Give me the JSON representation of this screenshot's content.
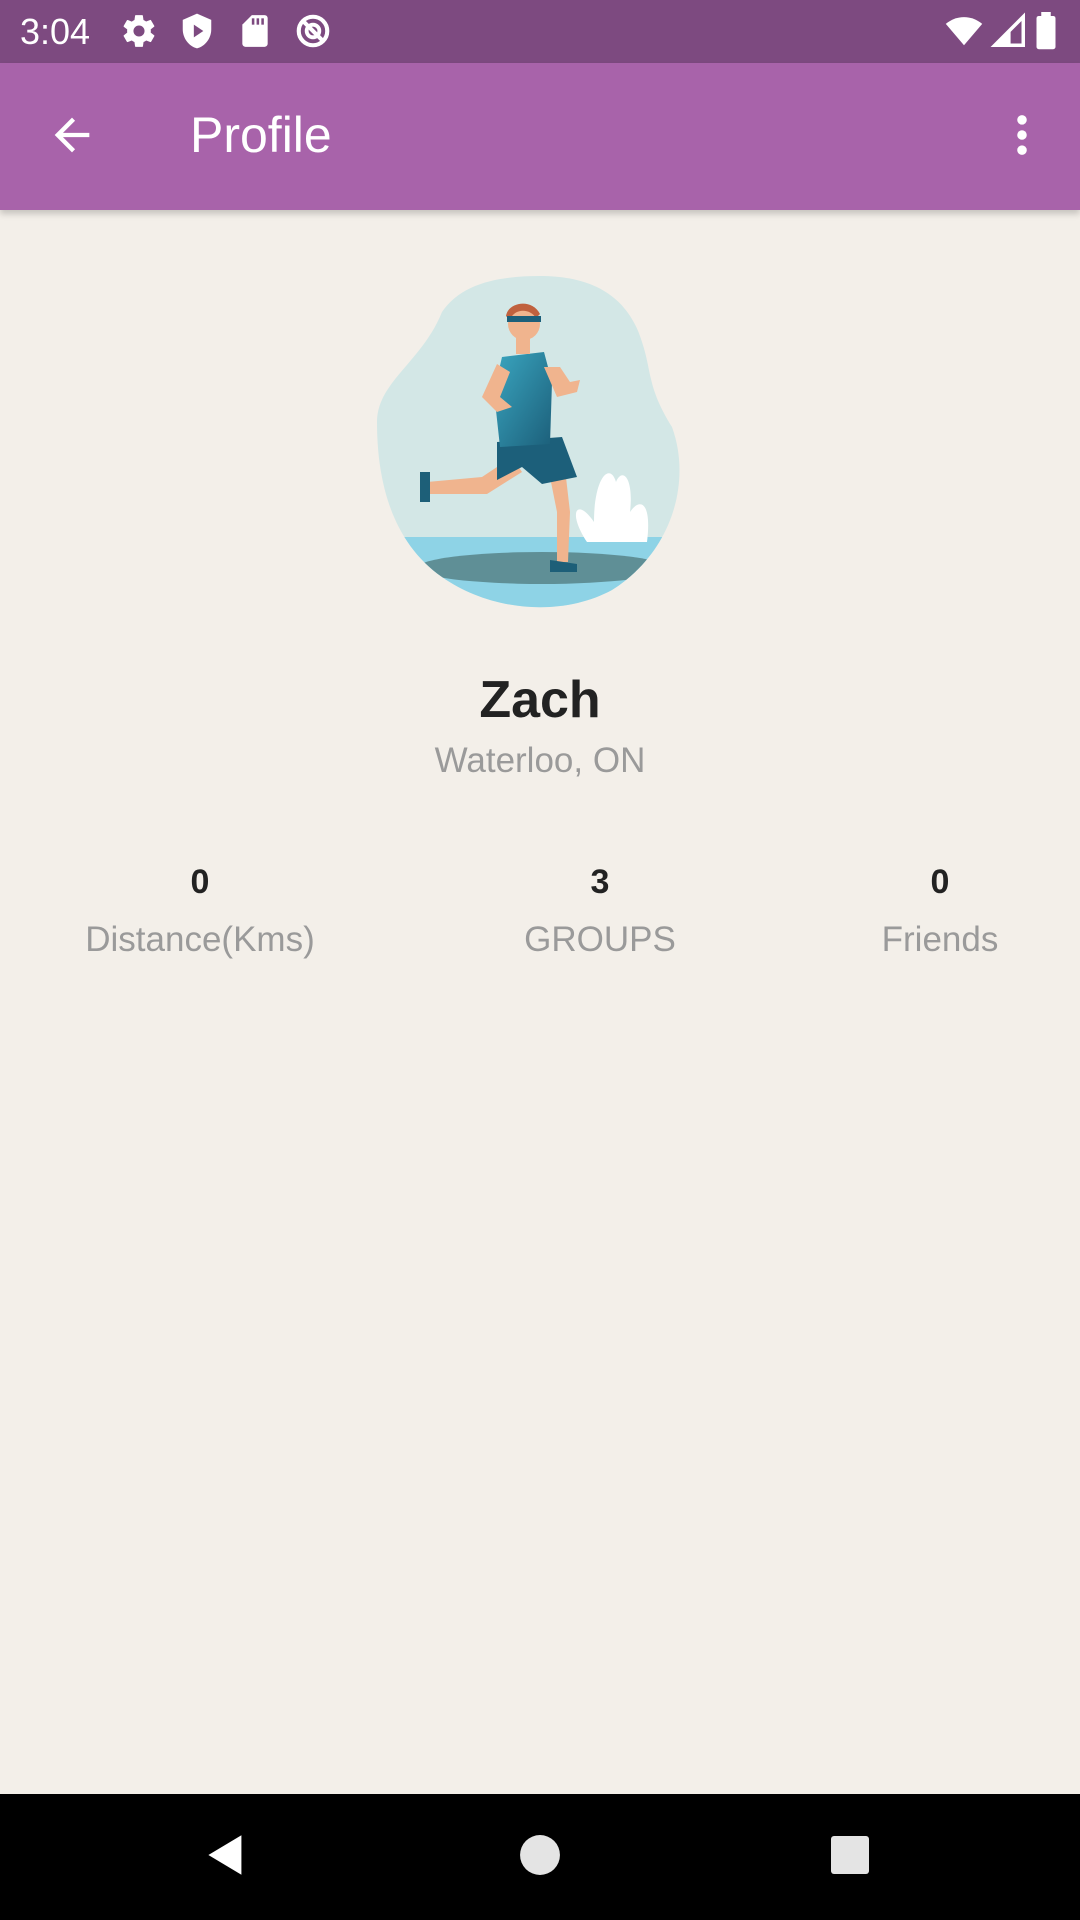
{
  "status_bar": {
    "time": "3:04",
    "left_icons": [
      "gear-icon",
      "shield-play-icon",
      "sd-card-icon",
      "no-sync-icon"
    ],
    "right_icons": [
      "wifi-icon",
      "signal-icon",
      "battery-icon"
    ],
    "background": "#7d4a80"
  },
  "app_bar": {
    "title": "Profile",
    "background": "#a863aa",
    "back_icon": "arrow-back-icon",
    "menu_icon": "more-vert-icon"
  },
  "profile": {
    "avatar": "runner-illustration",
    "name": "Zach",
    "location": "Waterloo, ON"
  },
  "stats": [
    {
      "value": "0",
      "label": "Distance(Kms)"
    },
    {
      "value": "3",
      "label": "GROUPS"
    },
    {
      "value": "0",
      "label": "Friends"
    }
  ],
  "nav_bar": {
    "buttons": [
      "back-triangle-icon",
      "home-circle-icon",
      "recents-square-icon"
    ]
  },
  "colors": {
    "background": "#f3efe9",
    "primary": "#a863aa",
    "primary_dark": "#7d4a80",
    "text_primary": "#222222",
    "text_secondary": "#9a9a9a"
  }
}
